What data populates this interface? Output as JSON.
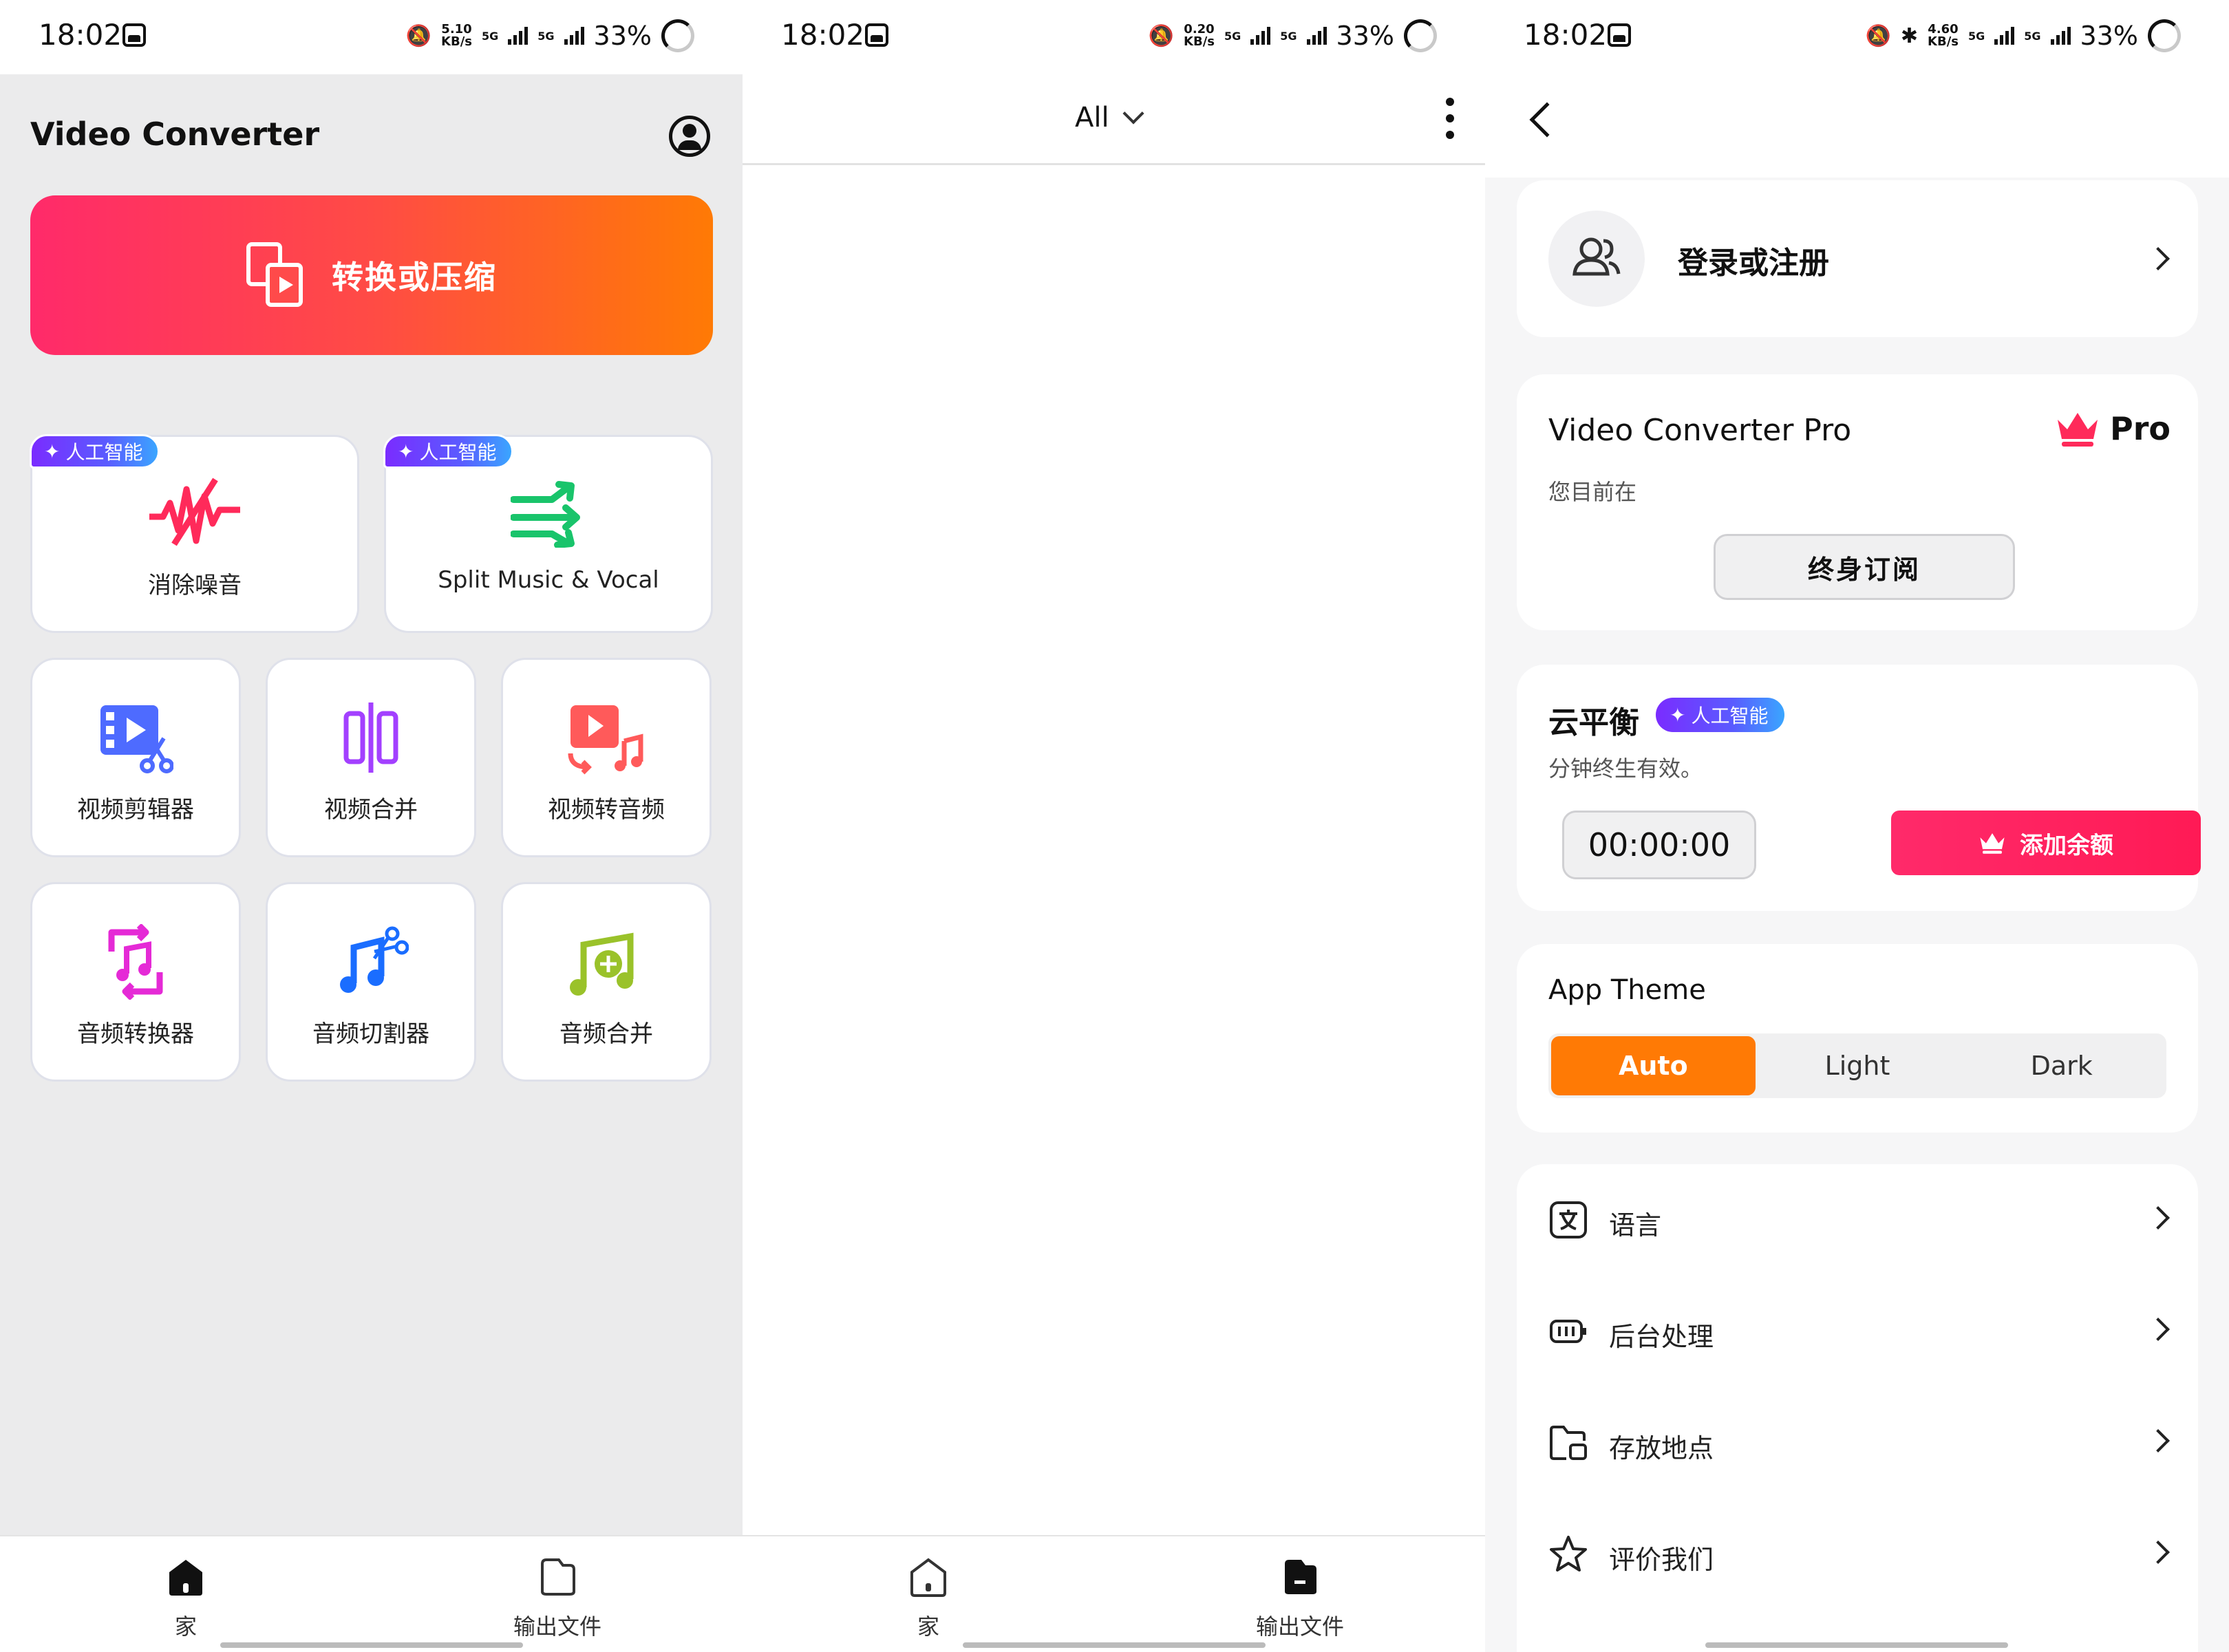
{
  "status_bars": [
    {
      "time": "18:02",
      "speed": "5.10",
      "speed_unit": "KB/s",
      "net1": "5G",
      "net2": "5G",
      "battery": "33%"
    },
    {
      "time": "18:02",
      "speed": "0.20",
      "speed_unit": "KB/s",
      "net1": "5G",
      "net2": "5G",
      "battery": "33%"
    },
    {
      "time": "18:02",
      "speed": "4.60",
      "speed_unit": "KB/s",
      "net1": "5G",
      "net2": "5G",
      "battery": "33%"
    }
  ],
  "home": {
    "app_title": "Video Converter",
    "convert_button": "转换或压缩",
    "ai_badge": "人工智能",
    "tools": {
      "denoise": "消除噪音",
      "split": "Split Music & Vocal",
      "video_editor": "视频剪辑器",
      "video_merge": "视频合并",
      "video_to_audio": "视频转音频",
      "audio_converter": "音频转换器",
      "audio_cutter": "音频切割器",
      "audio_merge": "音频合并"
    }
  },
  "nav": {
    "home": "家",
    "output": "输出文件"
  },
  "output_page": {
    "filter": "All"
  },
  "settings": {
    "login": "登录或注册",
    "pro_title": "Video Converter Pro",
    "pro_badge": "Pro",
    "pro_sub": "您目前在",
    "lifetime_button": "终身订阅",
    "cloud_title": "云平衡",
    "cloud_badge": "人工智能",
    "cloud_sub": "分钟终生有效。",
    "timer": "00:00:00",
    "add_button": "添加余额",
    "theme_title": "App Theme",
    "theme_options": [
      "Auto",
      "Light",
      "Dark"
    ],
    "menu": {
      "language": "语言",
      "background": "后台处理",
      "storage": "存放地点",
      "rate": "评价我们"
    }
  },
  "colors": {
    "accent_gradient_start": "#ff2a6a",
    "accent_gradient_end": "#ff7a05",
    "theme_active": "#ff7a05",
    "ai_badge_start": "#7a2cff",
    "ai_badge_end": "#3aa6ff"
  }
}
